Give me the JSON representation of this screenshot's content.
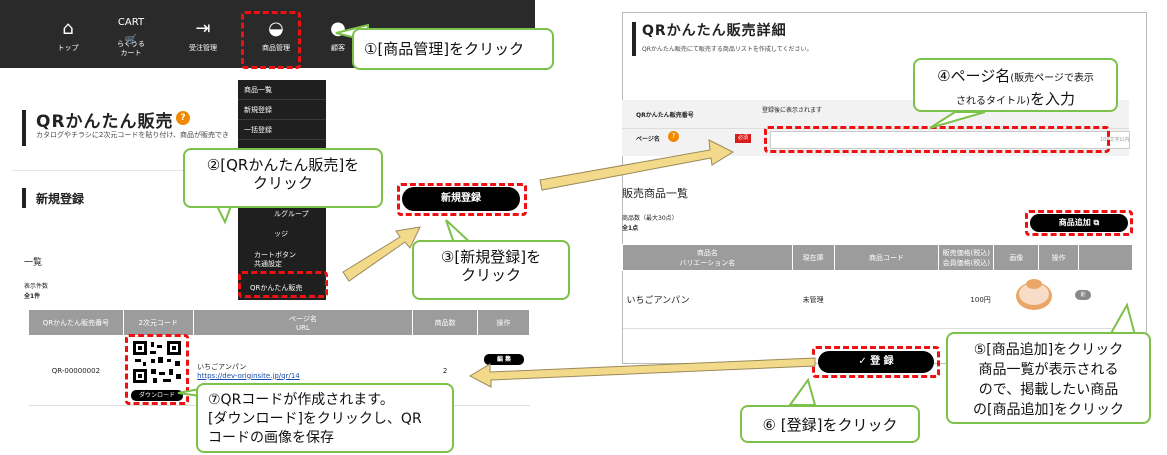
{
  "nav": {
    "items": [
      {
        "label": "トップ",
        "icon": "home-icon"
      },
      {
        "label": "らくうる\nカート",
        "icon_text": "CART",
        "icon": "cart-icon"
      },
      {
        "label": "受注管理",
        "icon": "inbox-icon"
      },
      {
        "label": "商品管理",
        "icon": "basket-icon"
      },
      {
        "label": "顧客",
        "icon": "person-icon"
      }
    ]
  },
  "dropdown": {
    "items": [
      "商品一覧",
      "新規登録",
      "一括登録",
      "",
      "",
      "ルグループ",
      "ッジ",
      "カートボタン\n共通設定",
      "QRかんたん販売"
    ]
  },
  "left": {
    "title": "QRかんたん販売",
    "help": "?",
    "description": "カタログやチラシに2次元コードを貼り付け、商品が販売でき",
    "new_section": "新規登録",
    "new_button": "新規登録",
    "list_title": "一覧",
    "count_label": "表示件数",
    "count_value": "全1件",
    "table": {
      "headers": [
        "QRかんたん販売番号",
        "2次元コード",
        "ページ名\nURL",
        "商品数",
        "操作"
      ],
      "row": {
        "number": "QR-00000002",
        "download": "ダウンロード",
        "page_name": "いちごアンパン",
        "url": "https://dev-originsite.jp/qr/14",
        "count": "2",
        "edit": "編 集"
      }
    }
  },
  "right": {
    "title": "QRかんたん販売詳細",
    "subtitle": "QRかんたん販売にて販売する商品リストを作成してください。",
    "number_label": "QRかんたん販売番号",
    "number_value": "登録後に表示されます",
    "page_label": "ページ名",
    "required": "必須",
    "char_limit": "100文字以内",
    "list_title": "販売商品一覧",
    "count_label": "商品数（最大30点）",
    "count_value": "全1点",
    "add_button": "商品追加",
    "table": {
      "headers": [
        "商品名\nバリエーション名",
        "現在庫",
        "商品コード",
        "販売価格(税込)\n会員価格(税込)",
        "画像",
        "操作"
      ],
      "row": {
        "name": "いちごアンパン",
        "stock": "未管理",
        "price": "100円",
        "op": "削"
      }
    },
    "register_button": "登 録"
  },
  "callouts": {
    "c1": "①[商品管理]をクリック",
    "c2": "②[QRかんたん販売]を\nクリック",
    "c3": "③[新規登録]を\nクリック",
    "c4a": "④ページ名",
    "c4b": "(販売ページで表示",
    "c4c": "されるタイトル)",
    "c4d": "を入力",
    "c5": "⑤[商品追加]をクリック\n商品一覧が表示される\nので、掲載したい商品\nの[商品追加]をクリック",
    "c6": "⑥ [登録]をクリック",
    "c7": "⑦QRコードが作成されます。\n[ダウンロード]をクリックし、QR\nコードの画像を保存"
  },
  "colors": {
    "accent_red": "#e11111",
    "callout_border": "#7cc14a",
    "arrow_fill": "#f3d98a",
    "nav_bg": "#2a2a2a"
  }
}
